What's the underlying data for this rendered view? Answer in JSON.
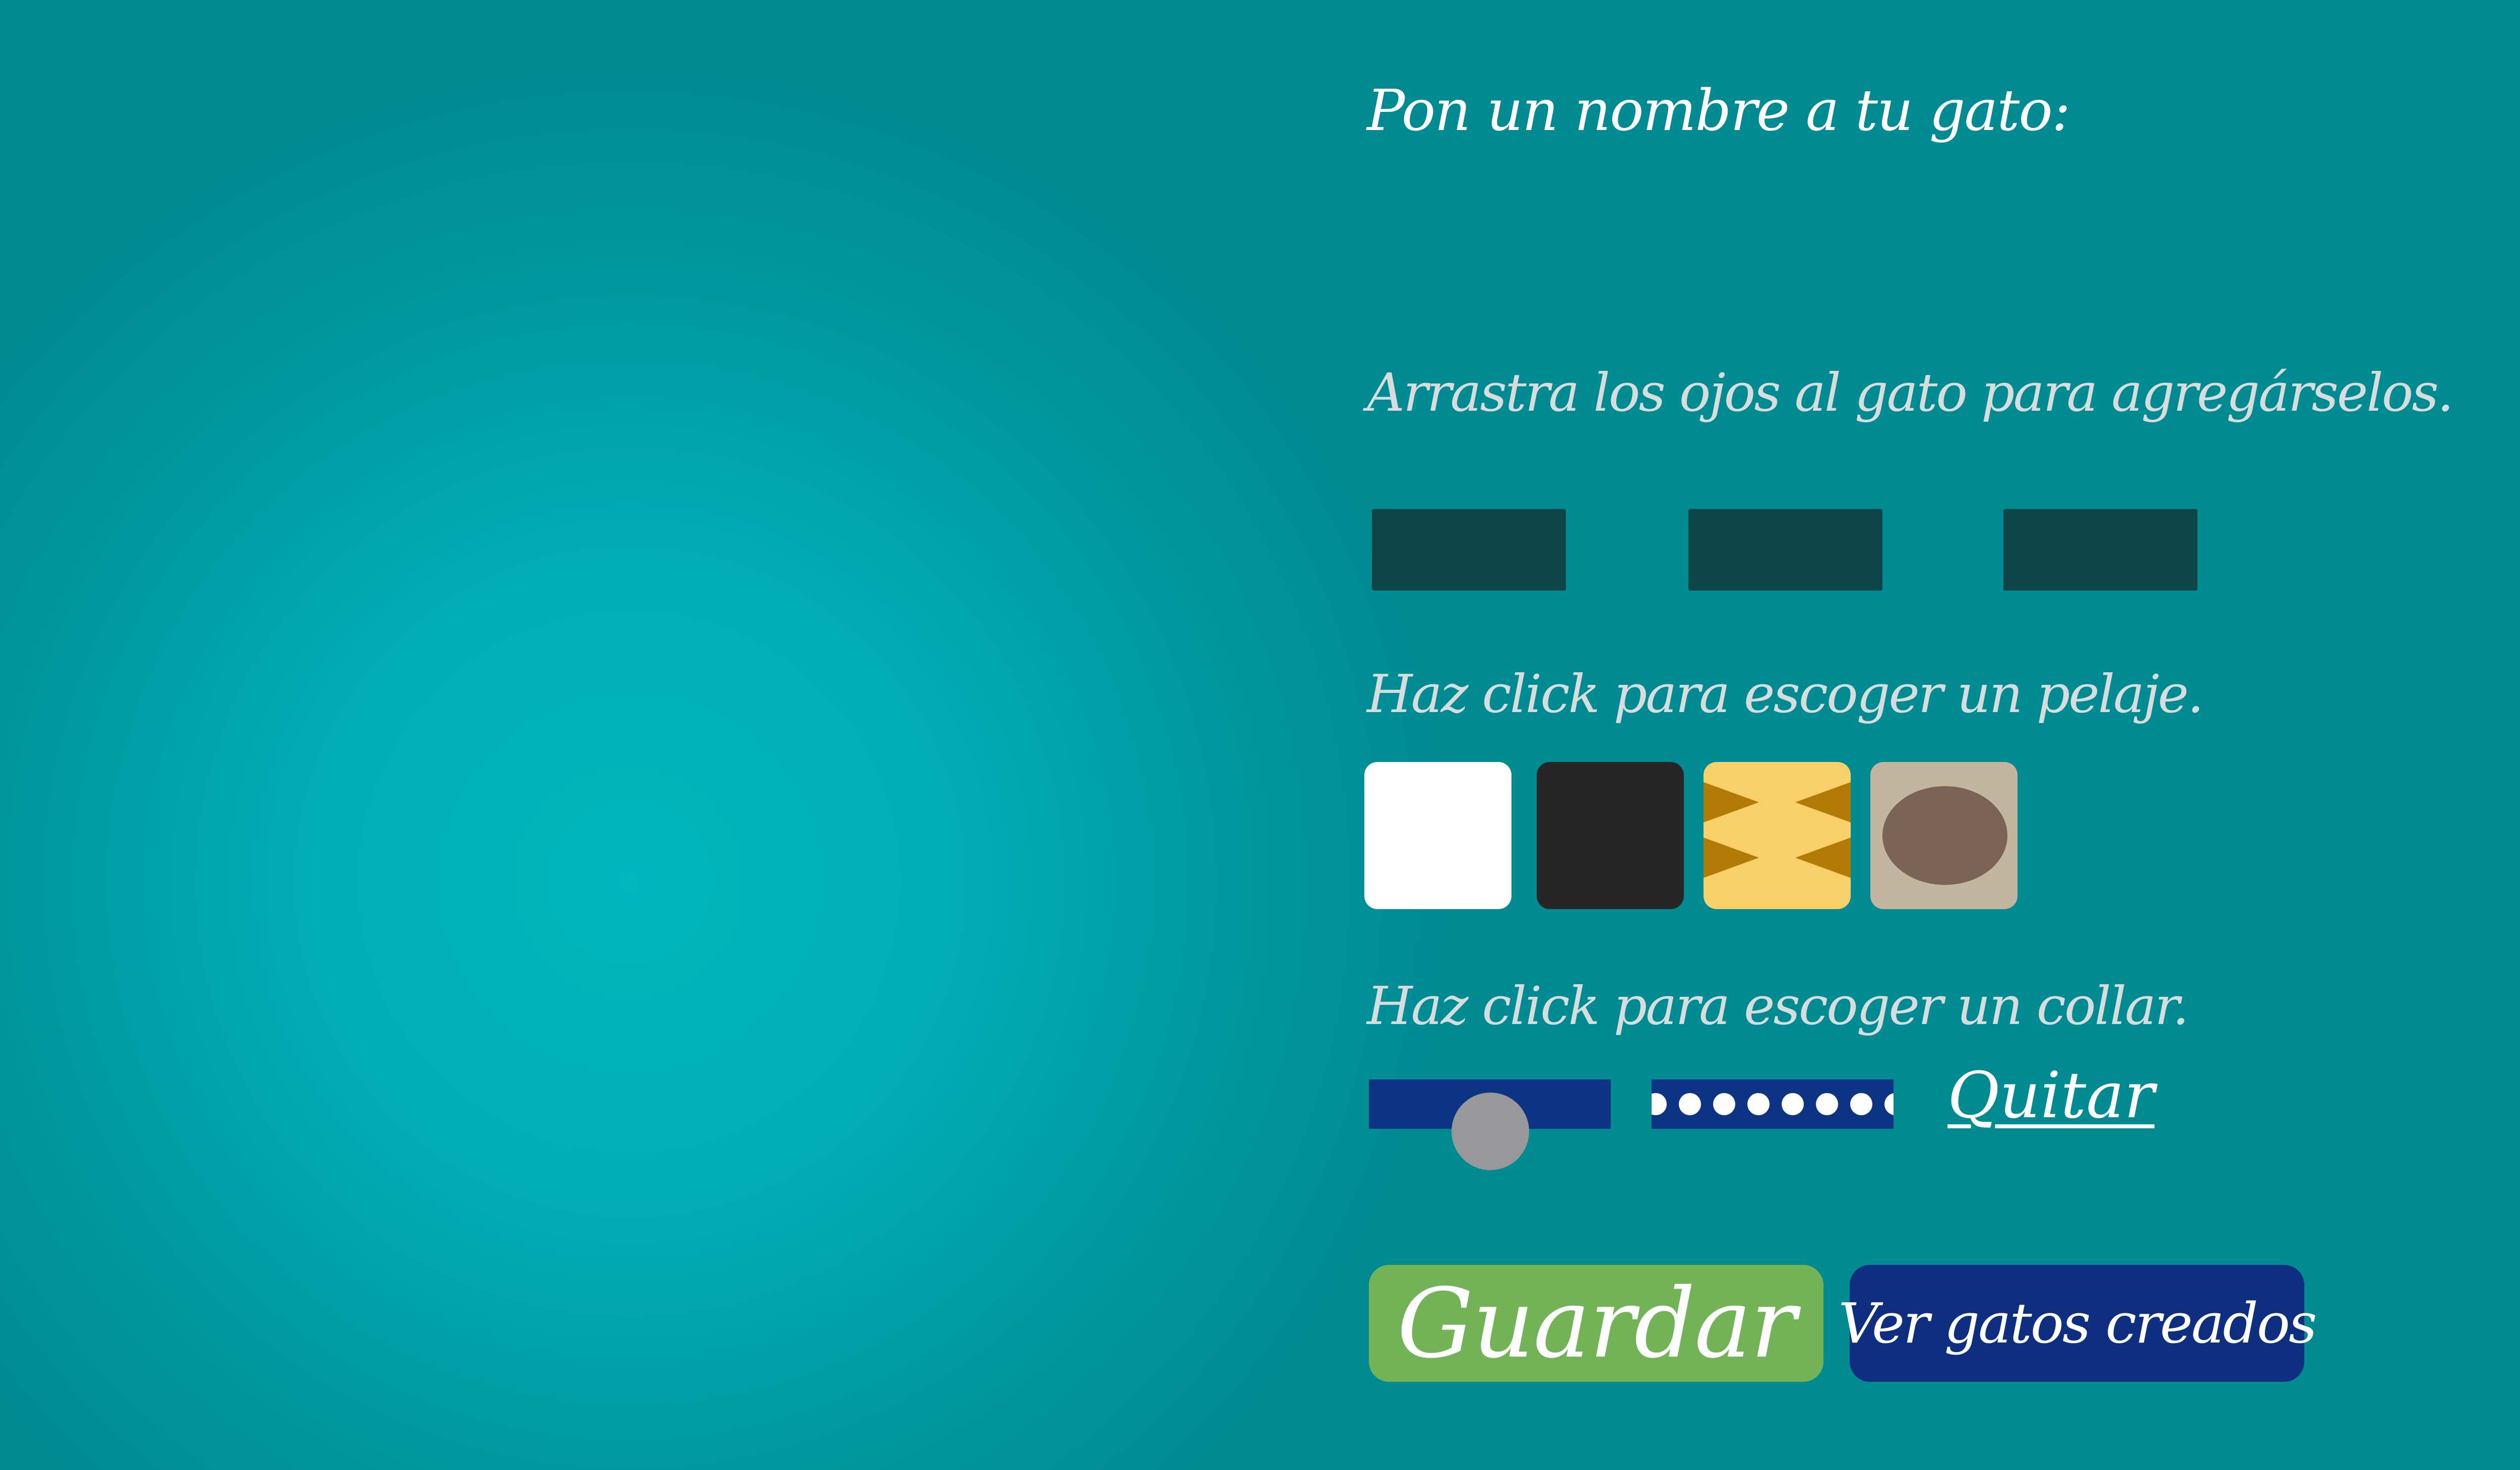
{
  "name_section": {
    "title": "Pon un nombre a tu gato:"
  },
  "eyes_section": {
    "instruction": "Arrastra los ojos al gato para agregárselos.",
    "slots": 3,
    "slot_color": "#0b4449"
  },
  "fur_section": {
    "instruction": "Haz click para escoger un pelaje.",
    "options": [
      {
        "name": "white",
        "color": "#ffffff"
      },
      {
        "name": "black",
        "color": "#262626"
      },
      {
        "name": "tiger",
        "color": "#f8cf69",
        "pattern_color": "#b17b06"
      },
      {
        "name": "spotted",
        "color": "#c2b69e",
        "pattern_color": "#7b6455"
      }
    ]
  },
  "collar_section": {
    "instruction": "Haz click para escoger un collar.",
    "options": [
      {
        "name": "bell-collar",
        "color": "#0d3484",
        "bell_color": "#98989a"
      },
      {
        "name": "pearl-collar",
        "color": "#0d3484",
        "pearl_color": "#ffffff"
      }
    ],
    "remove_label": "Quitar"
  },
  "actions": {
    "save_label": "Guardar",
    "save_color": "#71b356",
    "view_label": "Ver gatos creados",
    "view_color": "#0e2f80"
  },
  "colors": {
    "background": "#0097a0",
    "background_center": "#00b7be",
    "heading_text": "#d7dcdd"
  }
}
